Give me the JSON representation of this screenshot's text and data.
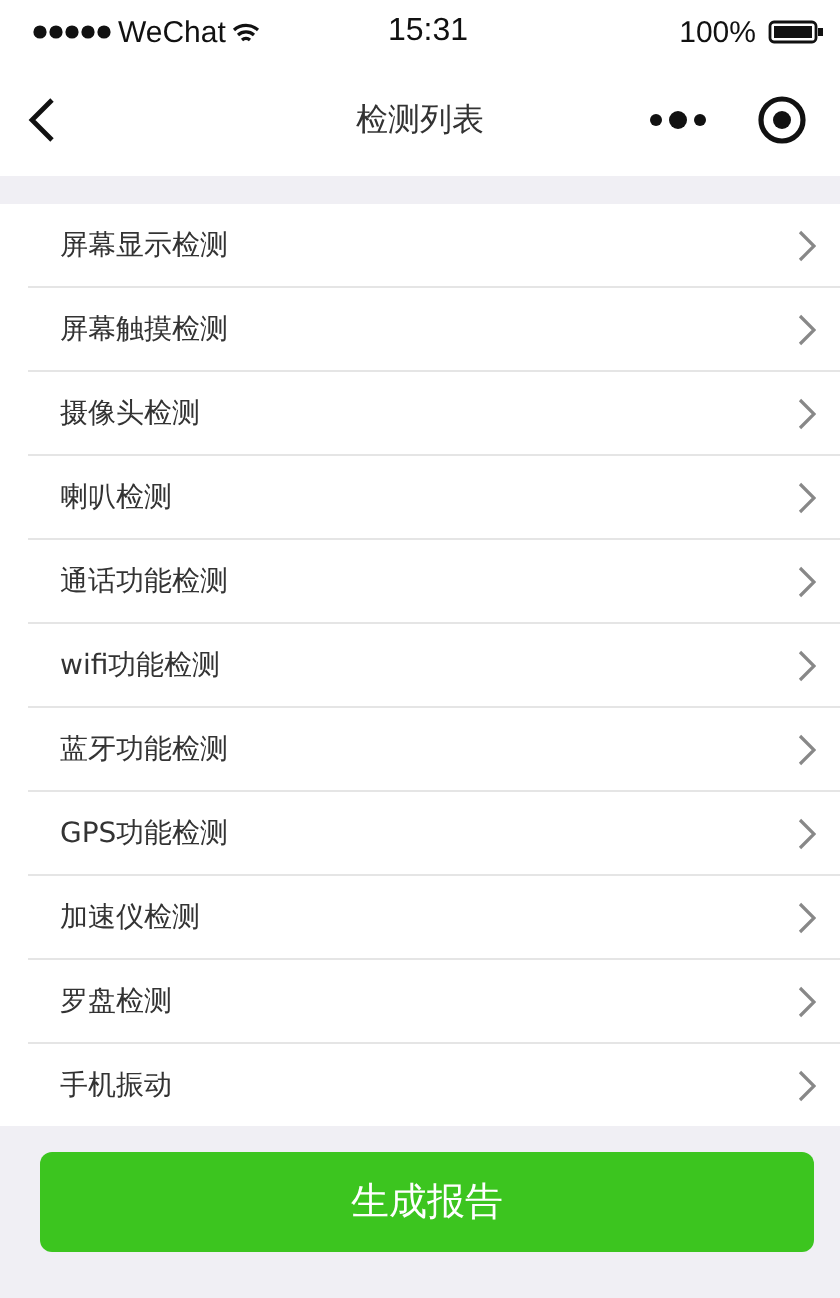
{
  "status_bar": {
    "carrier": "WeChat",
    "time": "15:31",
    "battery": "100%"
  },
  "nav": {
    "title": "检测列表"
  },
  "items": [
    {
      "label": "屏幕显示检测"
    },
    {
      "label": "屏幕触摸检测"
    },
    {
      "label": "摄像头检测"
    },
    {
      "label": "喇叭检测"
    },
    {
      "label": "通话功能检测"
    },
    {
      "label": "wifi功能检测"
    },
    {
      "label": "蓝牙功能检测"
    },
    {
      "label": "GPS功能检测"
    },
    {
      "label": "加速仪检测"
    },
    {
      "label": "罗盘检测"
    },
    {
      "label": "手机振动"
    }
  ],
  "button": {
    "label": "生成报告"
  }
}
